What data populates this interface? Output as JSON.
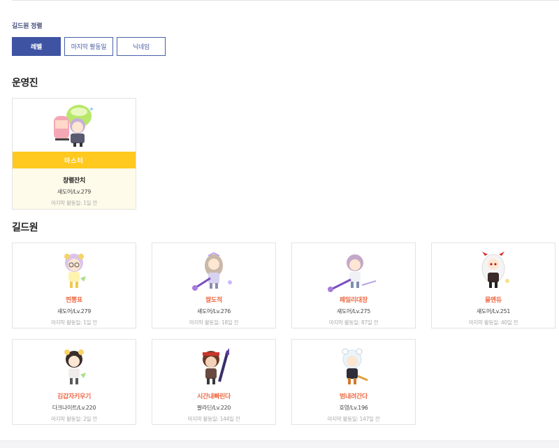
{
  "sort": {
    "label": "길드원 정렬",
    "buttons": [
      "레벨",
      "마지막 활동일",
      "닉네임"
    ],
    "active_index": 0
  },
  "staff_section": {
    "title": "운영진",
    "master": {
      "badge": "마스터",
      "name": "창렬잔치",
      "job": "섀도어/Lv.279",
      "last_active": "마지막 활동일: 1일 전"
    }
  },
  "members_section": {
    "title": "길드원",
    "members": [
      {
        "name": "찐뽕표",
        "job": "섀도어/Lv.279",
        "last_active": "마지막 활동일: 1일 전"
      },
      {
        "name": "쌀도적",
        "job": "섀도어/Lv.276",
        "last_active": "마지막 활동일: 18일 전"
      },
      {
        "name": "패밀리대장",
        "job": "섀도어/Lv.275",
        "last_active": "마지막 활동일: 87일 전"
      },
      {
        "name": "물멘듀",
        "job": "섀도어/Lv.251",
        "last_active": "마지막 활동일: 40일 전"
      },
      {
        "name": "김갑자키우기",
        "job": "다크나이트/Lv.220",
        "last_active": "마지막 활동일: 2일 전"
      },
      {
        "name": "시간내빠린다",
        "job": "팔라딘/Lv.220",
        "last_active": "마지막 활동일: 144일 전"
      },
      {
        "name": "범내려간다",
        "job": "호영/Lv.196",
        "last_active": "마지막 활동일: 147일 전"
      }
    ]
  },
  "colors": {
    "accent": "#3e54a3",
    "master_badge": "#ffc91f",
    "member_name": "#ef6a45"
  }
}
